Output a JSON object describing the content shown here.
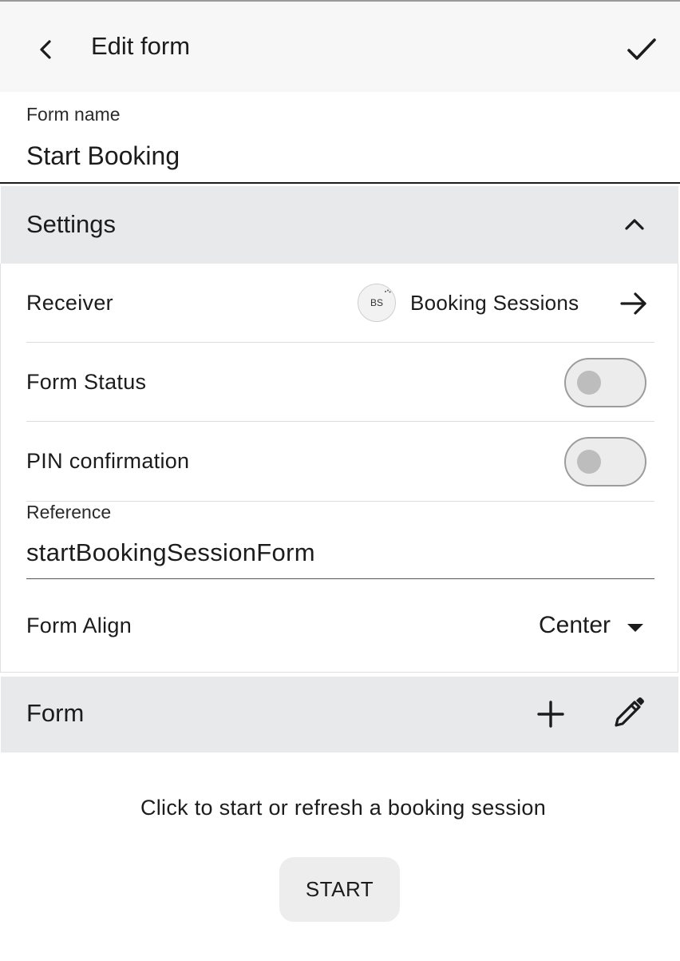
{
  "appbar": {
    "title": "Edit form"
  },
  "form_name": {
    "label": "Form name",
    "value": "Start Booking"
  },
  "settings": {
    "title": "Settings",
    "receiver": {
      "label": "Receiver",
      "avatar_initials": "BS",
      "value": "Booking Sessions"
    },
    "form_status": {
      "label": "Form Status",
      "enabled": false
    },
    "pin_confirmation": {
      "label": "PIN confirmation",
      "enabled": false
    },
    "reference": {
      "label": "Reference",
      "value": "startBookingSessionForm"
    },
    "form_align": {
      "label": "Form Align",
      "value": "Center"
    }
  },
  "form_section": {
    "title": "Form",
    "info_text": "Click to start or refresh a booking session",
    "start_button": "START"
  },
  "colors": {
    "appbar_bg": "#f7f7f7",
    "section_header_bg": "#e8e9eb",
    "button_bg": "#ededed",
    "toggle_off_track": "#ececec",
    "toggle_off_knob": "#bdbdbd"
  }
}
